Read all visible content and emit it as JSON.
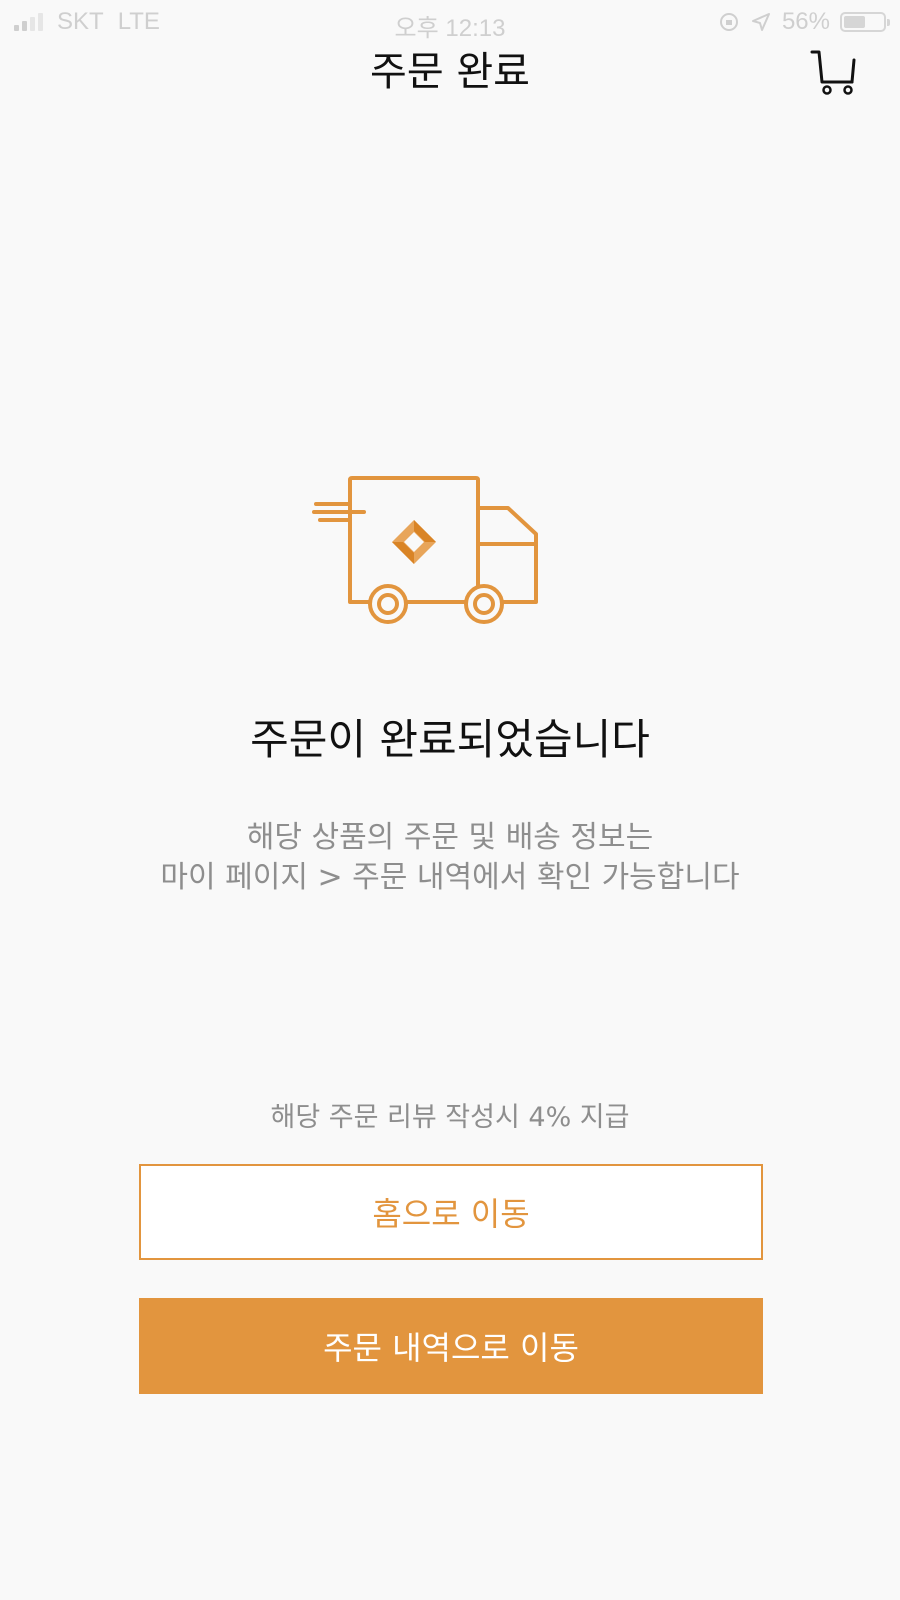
{
  "status_bar": {
    "carrier": "SKT",
    "network": "LTE",
    "time": "오후 12:13",
    "battery": "56%",
    "battery_level": 0.56
  },
  "header": {
    "title": "주문 완료",
    "cart_icon": "cart-icon"
  },
  "main": {
    "illustration_icon": "delivery-truck-icon",
    "heading": "주문이 완료되었습니다",
    "info_line1": "해당 상품의 주문 및 배송 정보는",
    "info_line2": "마이 페이지 > 주문 내역에서 확인 가능합니다",
    "reward_note": "해당 주문 리뷰 작성시 4% 지급"
  },
  "buttons": {
    "home_label": "홈으로 이동",
    "orders_label": "주문 내역으로 이동"
  },
  "colors": {
    "accent": "#e2953e",
    "background": "#f9f9f9",
    "muted_text": "#8e8e8e"
  }
}
